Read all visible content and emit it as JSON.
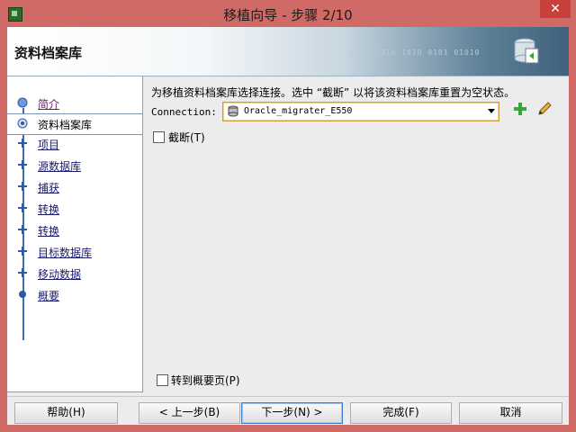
{
  "window": {
    "title": "移植向导 - 步骤 2/10",
    "close_glyph": "✕"
  },
  "header": {
    "title": "资料档案库",
    "decor_text": "0101 1010 1010 0101 01010"
  },
  "nav": {
    "items": [
      {
        "label": "简介",
        "state": "visited"
      },
      {
        "label": "资料档案库",
        "state": "current"
      },
      {
        "label": "项目",
        "state": "pending"
      },
      {
        "label": "源数据库",
        "state": "pending"
      },
      {
        "label": "捕获",
        "state": "pending"
      },
      {
        "label": "转换",
        "state": "pending"
      },
      {
        "label": "转换",
        "state": "pending"
      },
      {
        "label": "目标数据库",
        "state": "pending"
      },
      {
        "label": "移动数据",
        "state": "pending"
      },
      {
        "label": "概要",
        "state": "pending"
      }
    ]
  },
  "main": {
    "instruction": "为移植资料档案库选择连接。选中 “截断” 以将该资料档案库重置为空状态。",
    "connection_label": "Connection:",
    "connection_value": "Oracle_migrater_E550",
    "truncate_label": "截断(T)",
    "truncate_checked": false,
    "goto_summary_label": "转到概要页(P)",
    "goto_summary_checked": false
  },
  "footer": {
    "help": "帮助(H)",
    "back": "< 上一步(B)",
    "next": "下一步(N) >",
    "finish": "完成(F)",
    "cancel": "取消"
  },
  "colors": {
    "title_bar": "#cf6a66",
    "close_button": "#c7403a",
    "nav_line": "#3d6fb6",
    "focus_border": "#c79d3d"
  },
  "icons": [
    "app-icon",
    "database-icon",
    "add-icon",
    "edit-icon",
    "checked-step-icon",
    "current-step-icon",
    "step-icon"
  ]
}
